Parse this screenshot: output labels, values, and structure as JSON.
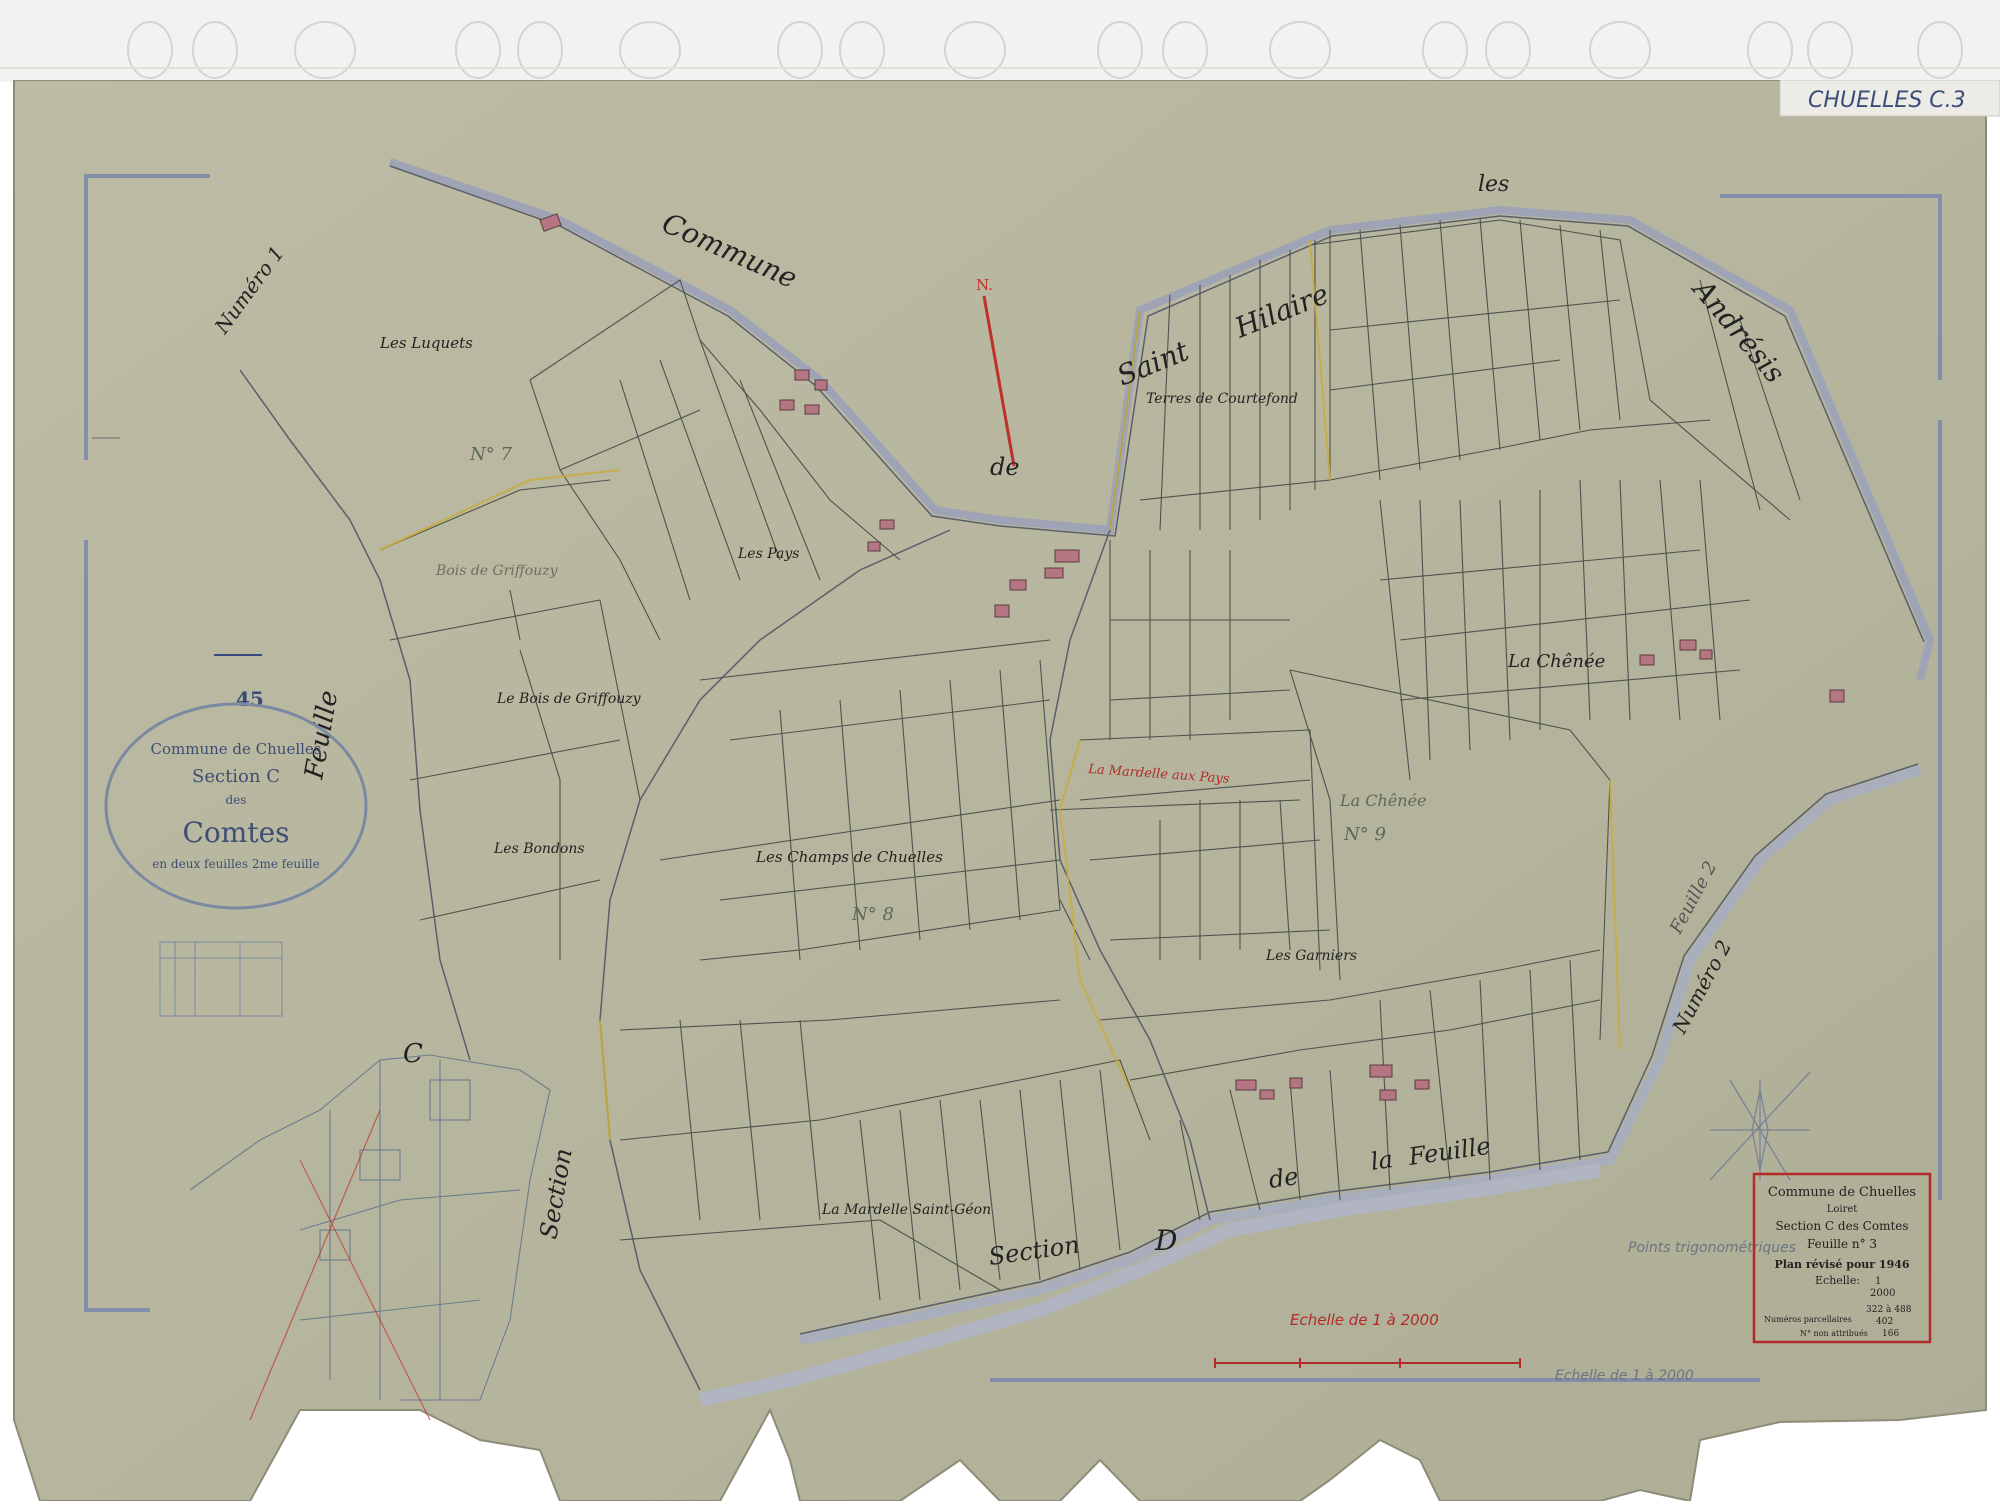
{
  "archive_label": "CHUELLES C.3",
  "sheet_number": "45",
  "commune_words": {
    "commune": "Commune",
    "de": "de",
    "saint": "Saint",
    "hilaire": "Hilaire",
    "les": "les",
    "andresis": "Andrésis"
  },
  "border_words": {
    "feuille_left": "Feuille",
    "c_left": "C",
    "numero1": "Numéro 1",
    "numero2": "Numéro 2",
    "feuille_right": "Feuille 2",
    "section_bottom": "Section",
    "d_bottom": "D",
    "de_bottom": "de",
    "la_bottom": "la",
    "feuille_bottom": "Feuille",
    "section_inset": "Section",
    "north": "N."
  },
  "places": {
    "les_luquets": "Les Luquets",
    "bois_griffouzy_old": "Bois de Griffouzy",
    "bois_griffouzy": "Le Bois de Griffouzy",
    "les_bondons": "Les Bondons",
    "les_pays": "Les Pays",
    "terres_courtefond": "Terres de Courtefond",
    "la_chenee": "La Chênée",
    "la_mardelle_pays": "La Mardelle aux Pays",
    "champs_chuelles": "Les Champs de Chuelles",
    "garniers": "Les Garniers",
    "mardelle_saint_geon": "La Mardelle Saint-Géon",
    "la_chenee_9": "La Chênée",
    "n9": "N° 9",
    "n8": "N° 8",
    "n7": "N° 7"
  },
  "old_cartouche": {
    "line1": "Commune de Chuelles",
    "line2": "Section C",
    "line3": "des",
    "line4": "Comtes",
    "line5": "en deux feuilles 2me feuille"
  },
  "cartouche": {
    "commune": "Commune de Chuelles",
    "dept": "Loiret",
    "section": "Section C des Comtes",
    "feuille": "Feuille n° 3",
    "plan": "Plan révisé pour 1946",
    "echelle_label": "Echelle:",
    "echelle_num": "1",
    "echelle_den": "2000",
    "numeros_label": "Numéros parcellaires",
    "numeros_range": "322 à 488",
    "numeros_line2": "402",
    "non_attribues_label": "N° non attribués",
    "non_attribues": "166"
  },
  "scale_text": "Echelle de 1 à 2000",
  "scale_text_old": "Echelle de 1 à 2000",
  "points_trig": "Points trigonométriques",
  "colors": {
    "paper": "#b9b8a0",
    "paper_dark": "#a8a890",
    "parcel_line": "#4a4f4a",
    "road": "#a4a9b8",
    "road_edge": "#7a7f8f",
    "red_ink": "#b32a2a",
    "blue_frame": "#7f8ea6",
    "yellow_edge": "#c8ac3c",
    "building": "#b07080"
  }
}
